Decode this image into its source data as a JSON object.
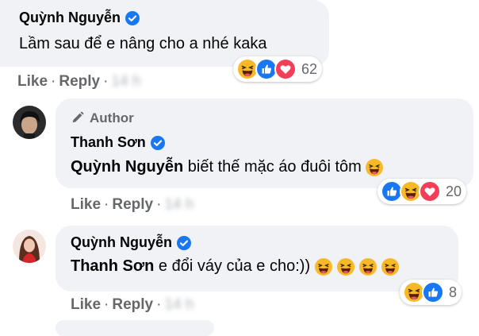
{
  "comments": [
    {
      "name": "Quỳnh Nguyễn",
      "text": "Lầm sau để e nâng cho a nhé kaka",
      "reaction_count": "62",
      "reactions": [
        "haha-icon",
        "like-icon",
        "love-icon"
      ],
      "like_label": "Like",
      "reply_label": "Reply",
      "time": "14 h"
    },
    {
      "author_badge": "Author",
      "name": "Thanh Sơn",
      "mention": "Quỳnh Nguyễn",
      "text": "biết thế mặc áo đuôi tôm",
      "reaction_count": "20",
      "reactions": [
        "like-icon",
        "haha-icon",
        "love-icon"
      ],
      "like_label": "Like",
      "reply_label": "Reply",
      "time": "14 h"
    },
    {
      "name": "Quỳnh Nguyễn",
      "mention": "Thanh Sơn",
      "text": "e đổi váy của e cho:))",
      "reaction_count": "8",
      "reactions": [
        "haha-icon",
        "like-icon"
      ],
      "like_label": "Like",
      "reply_label": "Reply",
      "time": "14 h"
    }
  ],
  "colors": {
    "bubble": "#f0f2f5",
    "verified": "#1877f2",
    "meta": "#65676b",
    "haha": "#f7b928",
    "like": "#1877f2",
    "love": "#f33e58"
  }
}
